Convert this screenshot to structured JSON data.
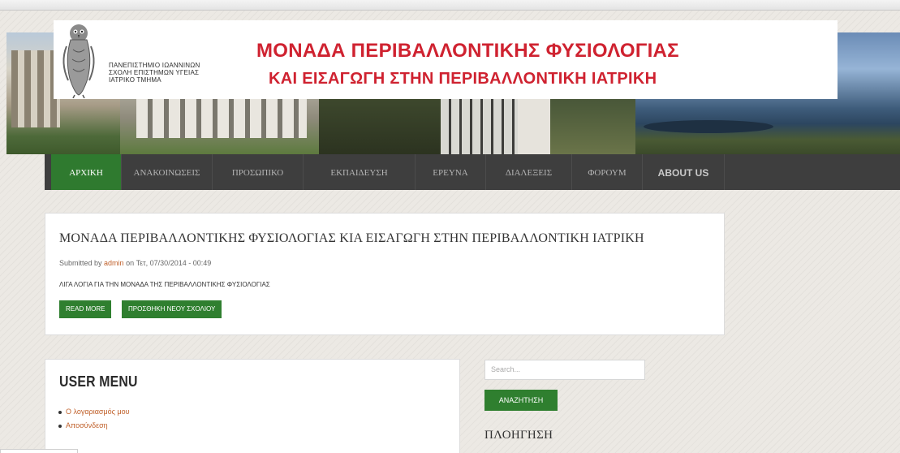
{
  "header": {
    "university_lines": [
      "ΠΑΝΕΠΙΣΤΗΜΙΟ ΙΩΑΝΝΙΝΩΝ",
      "ΣΧΟΛΗ ΕΠΙΣΤΗΜΩΝ ΥΓΕΙΑΣ",
      "ΙΑΤΡΙΚΟ ΤΜΗΜΑ"
    ],
    "title_line1": "ΜΟΝΑΔΑ ΠΕΡΙΒΑΛΛΟΝΤΙΚΗΣ ΦΥΣΙΟΛΟΓΙΑΣ",
    "title_line2": "ΚΑΙ ΕΙΣΑΓΩΓΗ ΣΤΗΝ ΠΕΡΙΒΑΛΛΟΝΤΙΚΗ ΙΑΤΡΙΚΗ",
    "title_color": "#cf2230"
  },
  "nav": {
    "items": [
      {
        "label": "ΑΡΧΙΚΗ",
        "active": true
      },
      {
        "label": "ΑΝΑΚΟΙΝΩΣΕΙΣ"
      },
      {
        "label": "ΠΡΟΣΩΠΙΚΟ"
      },
      {
        "label": "ΕΚΠΑΙΔΕΥΣΗ"
      },
      {
        "label": "ΕΡΕΥΝΑ"
      },
      {
        "label": "ΔΙΑΛΕΞΕΙΣ"
      },
      {
        "label": "ΦΟΡΟΥΜ"
      },
      {
        "label": "ABOUT US"
      }
    ],
    "active_color": "#2f7a2f"
  },
  "article": {
    "title": "ΜΟΝΑΔΑ ΠΕΡΙΒΑΛΛΟΝΤΙΚΗΣ ΦΥΣΙΟΛΟΓΙΑΣ ΚΙΑ ΕΙΣΑΓΩΓΗ ΣΤΗΝ ΠΕΡΙΒΑΛΛΟΝΤΙΚΗ ΙΑΤΡΙΚΗ",
    "submitted_prefix": "Submitted by",
    "author": "admin",
    "date_text": "on Τετ, 07/30/2014 - 00:49",
    "body": "ΛΙΓΑ ΛΟΓΙΑ ΓΙΑ ΤΗΝ ΜΟΝΑΔΑ ΤΗΣ ΠΕΡΙΒΑΛΛΟΝΤΙΚΗΣ ΦΥΣΙΟΛΟΓΙΑΣ",
    "read_more_label": "READ MORE",
    "add_comment_label": "ΠΡΟΣΘΗΚΗ ΝΕΟΥ ΣΧΟΛΙΟΥ"
  },
  "user_menu": {
    "title": "USER MENU",
    "items": [
      "Ο λογαριασμός μου",
      "Αποσύνδεση"
    ]
  },
  "sidebar": {
    "search_placeholder": "Search...",
    "search_button_label": "ΑΝΑΖΗΤΗΣΗ",
    "navigation_heading": "ΠΛΟΗΓΗΣΗ"
  },
  "colors": {
    "button_green": "#2f7f2f",
    "link_orange": "#c0602a",
    "nav_bg": "#3e3e3e"
  }
}
